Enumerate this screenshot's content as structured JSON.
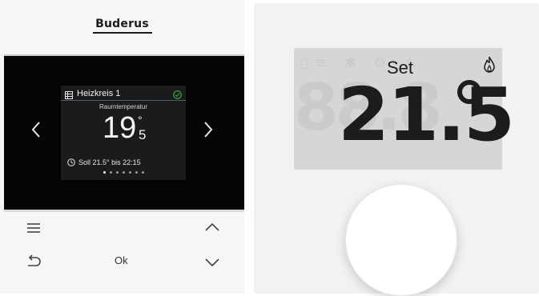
{
  "left_thermostat": {
    "brand": "Buderus",
    "screen": {
      "circuit_title": "Heizkreis 1",
      "label": "Raumtemperatur",
      "temperature_whole": "19",
      "temperature_decimal": "5",
      "degree_symbol": "°",
      "schedule_text": "Soll 21.5° bis 22:15",
      "page_count": 7,
      "active_page": 1
    },
    "buttons": {
      "ok_label": "Ok"
    },
    "icons": [
      "menu-icon",
      "back-icon",
      "chevron-up-icon",
      "chevron-down-icon",
      "chevron-left-icon",
      "chevron-right-icon",
      "grid-icon",
      "check-circle-icon",
      "clock-icon"
    ]
  },
  "right_thermostat": {
    "mode_label": "Set",
    "setpoint": "21.5",
    "degree_symbol": "°",
    "icons": [
      "flame-icon"
    ]
  },
  "colors": {
    "screen_background": "#1a1b1d",
    "check_green": "#3fae3b",
    "lcd_background": "#d6d6d5",
    "device_white": "#f6f6f6"
  }
}
